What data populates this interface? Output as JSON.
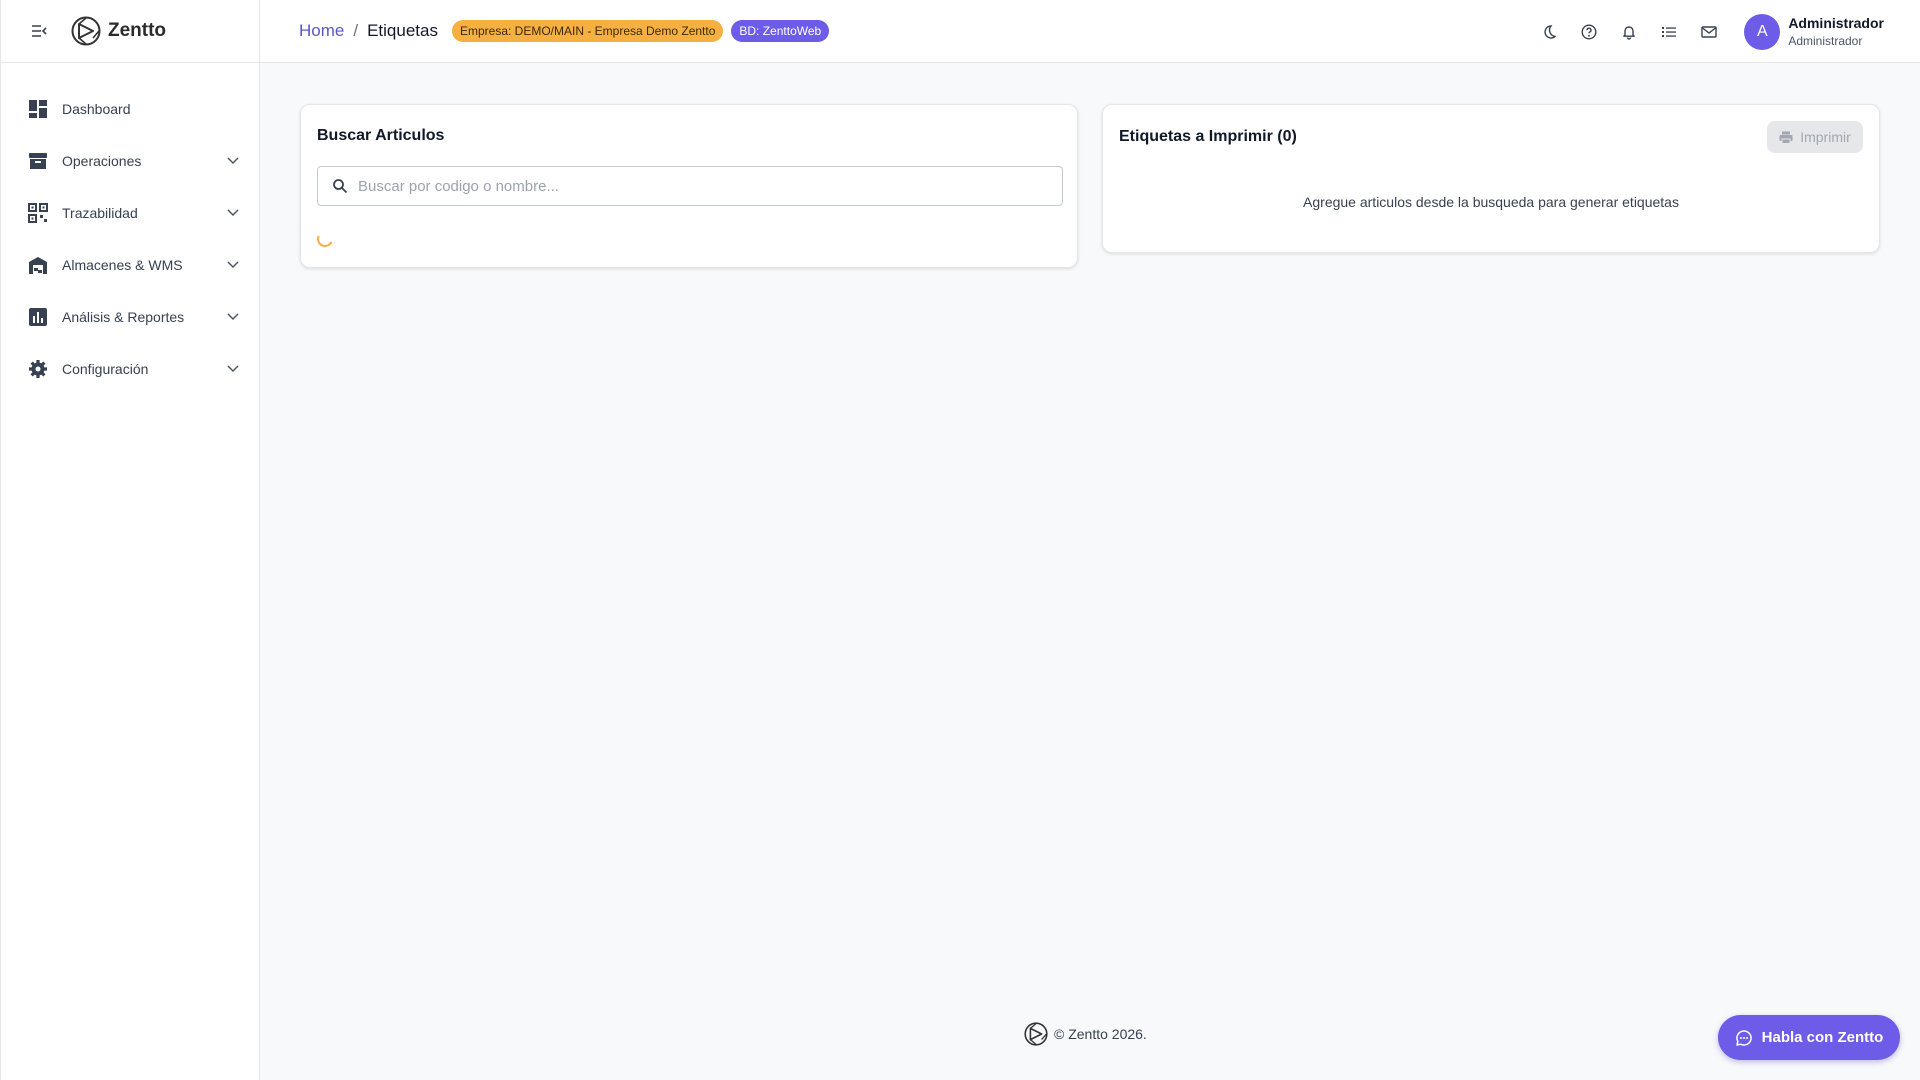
{
  "app": {
    "name": "Zentto"
  },
  "sidebar": {
    "items": [
      {
        "label": "Dashboard",
        "icon": "dashboard-icon",
        "expandable": false
      },
      {
        "label": "Operaciones",
        "icon": "archive-icon",
        "expandable": true
      },
      {
        "label": "Trazabilidad",
        "icon": "qr-code-icon",
        "expandable": true
      },
      {
        "label": "Almacenes & WMS",
        "icon": "warehouse-icon",
        "expandable": true
      },
      {
        "label": "Análisis & Reportes",
        "icon": "bar-chart-icon",
        "expandable": true
      },
      {
        "label": "Configuración",
        "icon": "gear-icon",
        "expandable": true
      }
    ]
  },
  "header": {
    "breadcrumb": {
      "home": "Home",
      "separator": "/",
      "current": "Etiquetas"
    },
    "badges": {
      "empresa": "Empresa: DEMO/MAIN - Empresa Demo Zentto",
      "bd": "BD: ZenttoWeb"
    },
    "user": {
      "avatar_letter": "A",
      "name": "Administrador",
      "role": "Administrador"
    }
  },
  "search_card": {
    "title": "Buscar Articulos",
    "placeholder": "Buscar por codigo o nombre..."
  },
  "labels_card": {
    "title": "Etiquetas a Imprimir (0)",
    "print_label": "Imprimir",
    "empty_message": "Agregue articulos desde la busqueda para generar etiquetas"
  },
  "footer": {
    "text": "© Zentto 2026."
  },
  "chat": {
    "label": "Habla con Zentto"
  },
  "colors": {
    "accent": "#6d5ce7",
    "badge_empresa": "#f5b041",
    "link": "#5b57c9"
  }
}
